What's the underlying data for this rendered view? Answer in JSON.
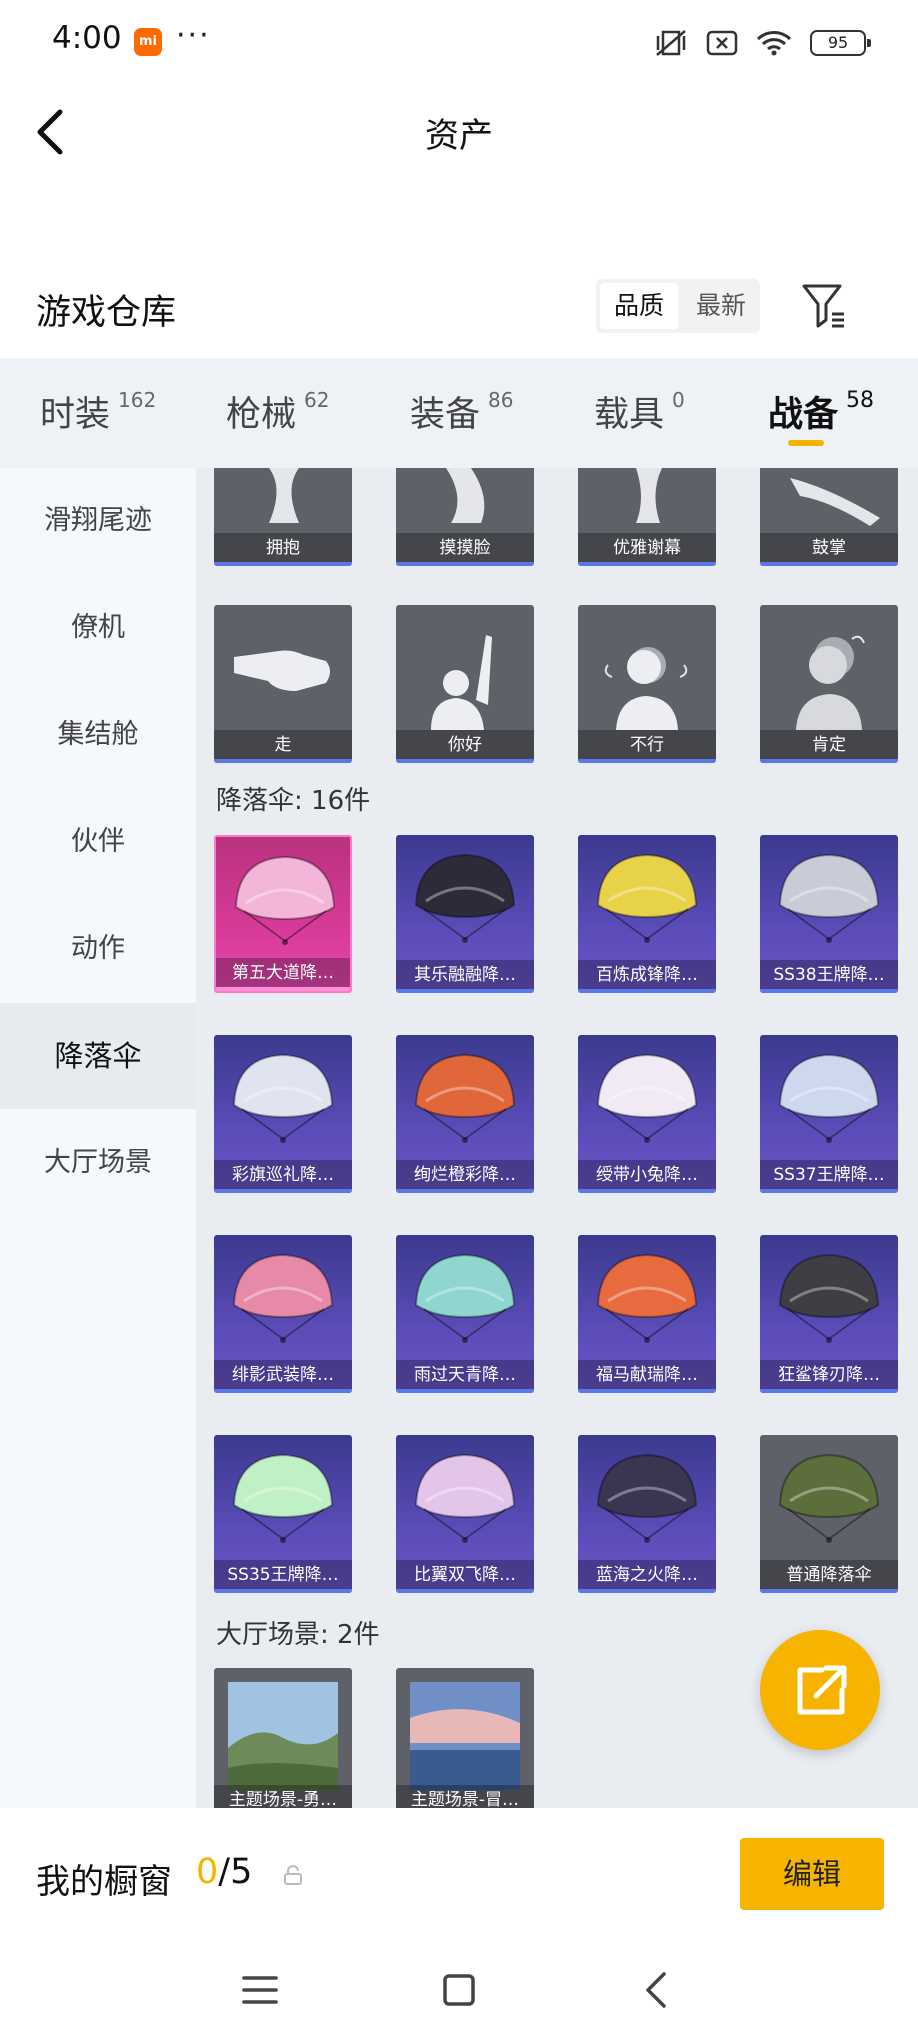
{
  "status_bar": {
    "time": "4:00",
    "app_badge": "mi",
    "more": "···",
    "battery": "95"
  },
  "header": {
    "title": "资产"
  },
  "warehouse": {
    "label": "游戏仓库",
    "sort_options": [
      "品质",
      "最新"
    ],
    "sort_active": "品质"
  },
  "category_tabs": [
    {
      "name": "时装",
      "count": "162",
      "active": false
    },
    {
      "name": "枪械",
      "count": "62",
      "active": false
    },
    {
      "name": "装备",
      "count": "86",
      "active": false
    },
    {
      "name": "载具",
      "count": "0",
      "active": false
    },
    {
      "name": "战备",
      "count": "58",
      "active": true
    }
  ],
  "sidebar": [
    {
      "label": "滑翔尾迹",
      "active": false
    },
    {
      "label": "僚机",
      "active": false
    },
    {
      "label": "集结舱",
      "active": false
    },
    {
      "label": "伙伴",
      "active": false
    },
    {
      "label": "动作",
      "active": false
    },
    {
      "label": "降落伞",
      "active": true
    },
    {
      "label": "大厅场景",
      "active": false
    }
  ],
  "emotes_row1": [
    "拥抱",
    "摸摸脸",
    "优雅谢幕",
    "鼓掌"
  ],
  "emotes_row2": [
    "走",
    "你好",
    "不行",
    "肯定"
  ],
  "parachute_section": {
    "title": "降落伞: 16件"
  },
  "parachutes": [
    {
      "name": "第五大道降…",
      "tier": "pink",
      "color": "#f4b6d8"
    },
    {
      "name": "其乐融融降…",
      "tier": "purple",
      "color": "#2d2b3a"
    },
    {
      "name": "百炼成锋降…",
      "tier": "purple",
      "color": "#e8d24a"
    },
    {
      "name": "SS38王牌降…",
      "tier": "purple",
      "color": "#c9ccd6"
    },
    {
      "name": "彩旗巡礼降…",
      "tier": "purple",
      "color": "#dfe4ee"
    },
    {
      "name": "绚烂橙彩降…",
      "tier": "purple",
      "color": "#e0673a"
    },
    {
      "name": "绶带小兔降…",
      "tier": "purple",
      "color": "#f1e9f3"
    },
    {
      "name": "SS37王牌降…",
      "tier": "purple",
      "color": "#cdd8ee"
    },
    {
      "name": "绯影武装降…",
      "tier": "purple",
      "color": "#e68aa7"
    },
    {
      "name": "雨过天青降…",
      "tier": "purple",
      "color": "#8fd6cf"
    },
    {
      "name": "福马献瑞降…",
      "tier": "purple",
      "color": "#e86b3f"
    },
    {
      "name": "狂鲨锋刃降…",
      "tier": "purple",
      "color": "#3e3e44"
    },
    {
      "name": "SS35王牌降…",
      "tier": "purple",
      "color": "#bff0c6"
    },
    {
      "name": "比翼双飞降…",
      "tier": "purple",
      "color": "#e4c5ea"
    },
    {
      "name": "蓝海之火降…",
      "tier": "purple",
      "color": "#3a3550"
    },
    {
      "name": "普通降落伞",
      "tier": "gray",
      "color": "#5b6e3c"
    }
  ],
  "lobby_section": {
    "title": "大厅场景: 2件"
  },
  "lobby_scenes": [
    "主题场景-勇…",
    "主题场景-冒…"
  ],
  "showcase": {
    "label": "我的橱窗",
    "count_now": "0",
    "count_total": "/5",
    "edit_label": "编辑"
  },
  "colors": {
    "accent": "#f6b300",
    "purple_card": "#4b44a6",
    "pink_card": "#d73a98",
    "gray_card": "#5f6168"
  }
}
